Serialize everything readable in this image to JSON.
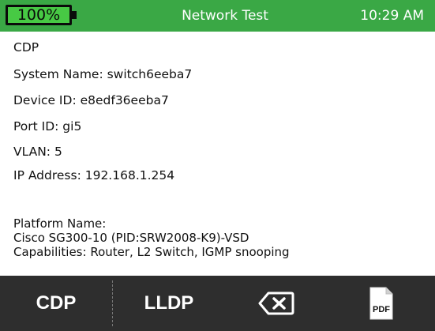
{
  "status_bar": {
    "battery": "100%",
    "title": "Network Test",
    "time": "10:29 AM"
  },
  "cdp": {
    "heading": "CDP",
    "system_name": "System Name: switch6eeba7",
    "device_id": "Device ID: e8edf36eeba7",
    "port_id": "Port ID: gi5",
    "vlan": "VLAN: 5",
    "ip_address": "IP Address: 192.168.1.254",
    "platform_label": "Platform Name:",
    "platform_value": "Cisco SG300-10 (PID:SRW2008-K9)-VSD",
    "capabilities": "Capabilities: Router, L2 Switch, IGMP snooping"
  },
  "toolbar": {
    "cdp_label": "CDP",
    "lldp_label": "LLDP",
    "pdf_label": "PDF",
    "back_icon": "backspace-icon",
    "pdf_icon": "pdf-file-icon"
  },
  "colors": {
    "status_bar": "#3aa845",
    "battery_fill": "#47c944",
    "toolbar": "#2e2e2e"
  }
}
